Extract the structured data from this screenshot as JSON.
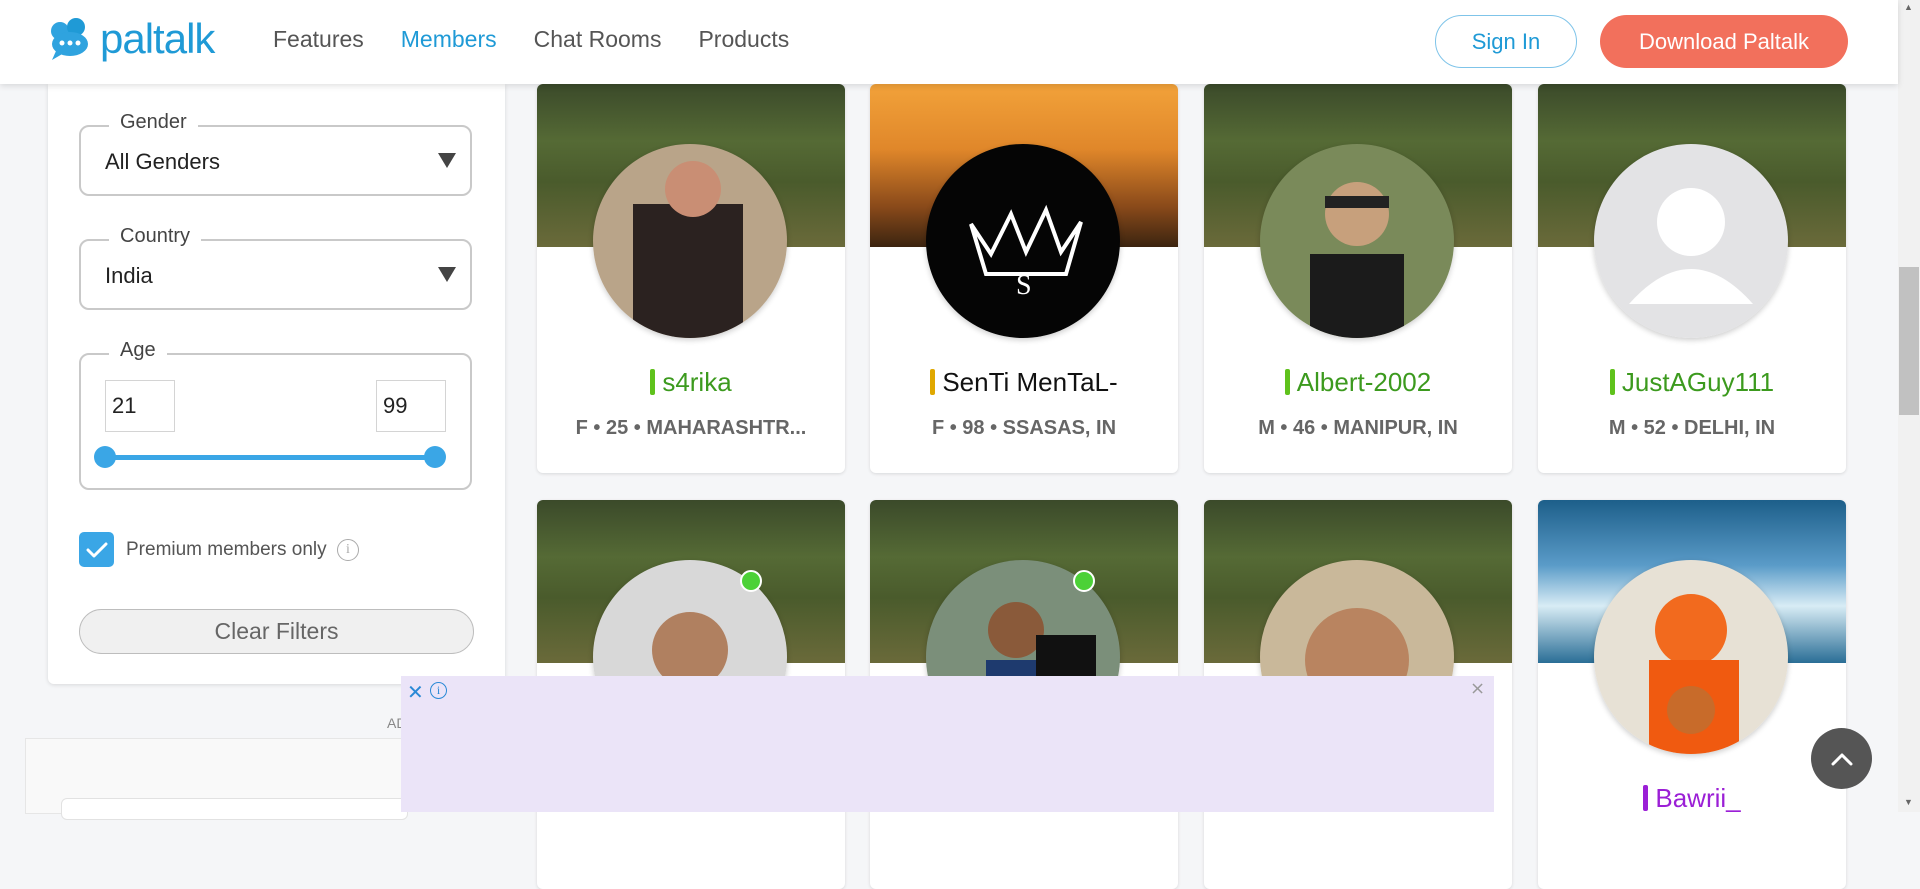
{
  "header": {
    "logo_text": "paltalk",
    "nav": [
      "Features",
      "Members",
      "Chat Rooms",
      "Products"
    ],
    "active_nav": "Members",
    "sign_in": "Sign In",
    "download": "Download Paltalk",
    "colors": {
      "brand": "#1f9ad6",
      "download_bg": "#f2705c"
    }
  },
  "filters": {
    "gender": {
      "legend": "Gender",
      "value": "All Genders"
    },
    "country": {
      "legend": "Country",
      "value": "India"
    },
    "age": {
      "legend": "Age",
      "min": "21",
      "max": "99",
      "range_fraction": [
        0.0,
        1.0
      ]
    },
    "premium_only": {
      "label": "Premium members only",
      "checked": true
    },
    "clear_label": "Clear Filters"
  },
  "ad": {
    "label": "AD",
    "close_icon": "close-icon",
    "info_icon": "info-icon"
  },
  "members": [
    {
      "name": "s4rika",
      "meta": "F • 25 • MAHARASHTR...",
      "name_color": "#3c9a1e",
      "bar_color": "#5fc21c",
      "cover": "forest",
      "online": false
    },
    {
      "name": "SenTi MenTaL-",
      "meta": "F • 98 • SSASAS, IN",
      "name_color": "#111111",
      "bar_color": "#e0a800",
      "cover": "sunset",
      "online": false
    },
    {
      "name": "Albert-2002",
      "meta": "M • 46 • MANIPUR, IN",
      "name_color": "#3c9a1e",
      "bar_color": "#5fc21c",
      "cover": "forest",
      "online": false
    },
    {
      "name": "JustAGuy111",
      "meta": "M • 52 • DELHI, IN",
      "name_color": "#3c9a1e",
      "bar_color": "#5fc21c",
      "cover": "forest",
      "online": false
    },
    {
      "name": "",
      "meta": "",
      "cover": "forest",
      "online": true
    },
    {
      "name": "",
      "meta": "",
      "cover": "forest",
      "online": true
    },
    {
      "name": "",
      "meta": "",
      "cover": "forest",
      "online": false
    },
    {
      "name": "Bawrii_",
      "meta": "",
      "name_color": "#9b1fd6",
      "bar_color": "#9b1fd6",
      "cover": "ocean",
      "online": false
    }
  ],
  "scroll_to_top_icon": "chevron-up-icon"
}
